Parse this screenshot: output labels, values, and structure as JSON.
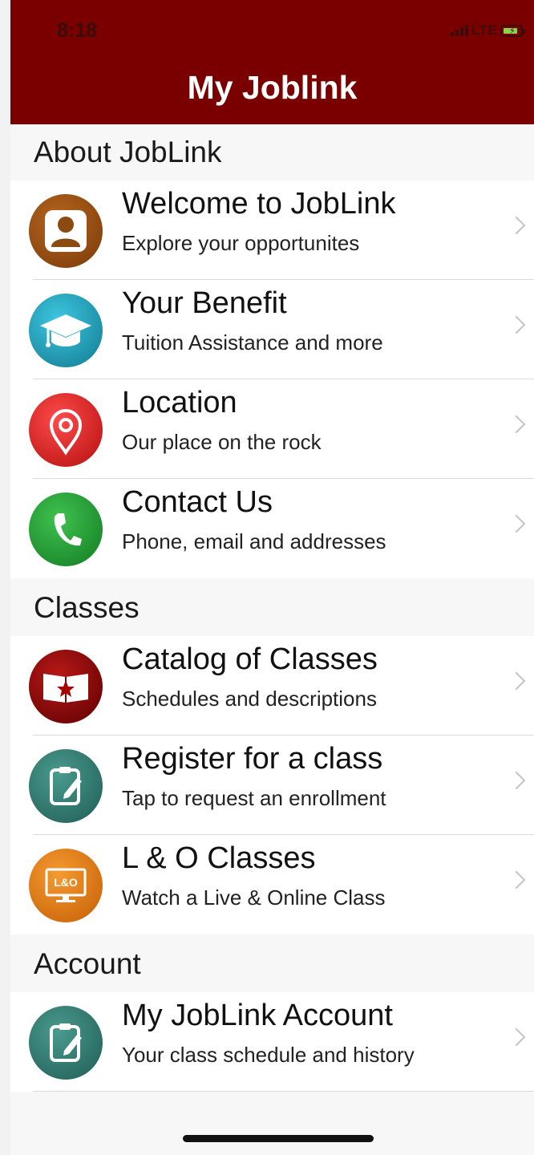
{
  "status_bar": {
    "time": "8:18",
    "network": "LTE"
  },
  "nav": {
    "title": "My Joblink"
  },
  "sections": [
    {
      "header": "About JobLink",
      "items": [
        {
          "title": "Welcome to JobLink",
          "subtitle": "Explore your opportunites",
          "icon": "person-icon",
          "color": "#8b4a12"
        },
        {
          "title": "Your Benefit",
          "subtitle": "Tuition Assistance and more",
          "icon": "graduation-cap-icon",
          "color": "#1b8fa8"
        },
        {
          "title": "Location",
          "subtitle": "Our place on the rock",
          "icon": "map-pin-icon",
          "color": "#d11b1b"
        },
        {
          "title": "Contact Us",
          "subtitle": "Phone, email and addresses",
          "icon": "phone-icon",
          "color": "#1f9a2e"
        }
      ]
    },
    {
      "header": "Classes",
      "items": [
        {
          "title": "Catalog of Classes",
          "subtitle": "Schedules and descriptions",
          "icon": "book-star-icon",
          "color": "#8a0a0a"
        },
        {
          "title": "Register for a class",
          "subtitle": "Tap to request an enrollment",
          "icon": "clipboard-edit-icon",
          "color": "#2f7a70"
        },
        {
          "title": "L & O Classes",
          "subtitle": "Watch a Live & Online Class",
          "icon": "monitor-lo-icon",
          "color": "#e07a10",
          "icon_text": "L&O"
        }
      ]
    },
    {
      "header": "Account",
      "items": [
        {
          "title": "My JobLink Account",
          "subtitle": "Your class schedule and history",
          "icon": "clipboard-edit-icon",
          "color": "#2f7a70"
        }
      ]
    }
  ]
}
